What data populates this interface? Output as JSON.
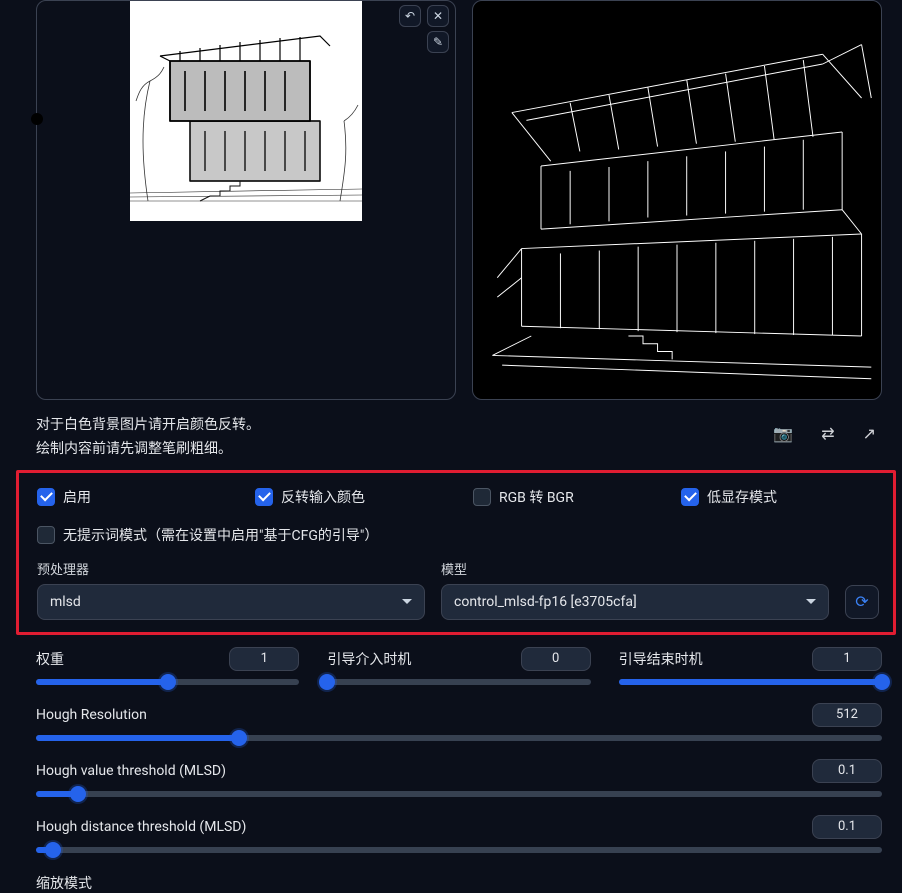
{
  "captions": {
    "line1": "对于白色背景图片请开启颜色反转。",
    "line2": "绘制内容前请先调整笔刷粗细。"
  },
  "toolbar_icons": {
    "camera": "camera-icon",
    "swap": "swap-icon",
    "out": "arrow-out-icon"
  },
  "checkboxes": {
    "enable": {
      "label": "启用",
      "checked": true
    },
    "invert": {
      "label": "反转输入颜色",
      "checked": true
    },
    "rgb_bgr": {
      "label": "RGB 转 BGR",
      "checked": false
    },
    "low_vram": {
      "label": "低显存模式",
      "checked": true
    },
    "no_prompt": {
      "label": "无提示词模式（需在设置中启用\"基于CFG的引导\"）",
      "checked": false
    }
  },
  "preprocessor": {
    "label": "预处理器",
    "value": "mlsd"
  },
  "model": {
    "label": "模型",
    "value": "control_mlsd-fp16 [e3705cfa]"
  },
  "sliders": {
    "weight": {
      "label": "权重",
      "value": "1",
      "percent": 50
    },
    "guide_start": {
      "label": "引导介入时机",
      "value": "0",
      "percent": 0
    },
    "guide_end": {
      "label": "引导结束时机",
      "value": "1",
      "percent": 100
    },
    "hough_res": {
      "label": "Hough Resolution",
      "value": "512",
      "percent": 24
    },
    "hough_val": {
      "label": "Hough value threshold (MLSD)",
      "value": "0.1",
      "percent": 5
    },
    "hough_dist": {
      "label": "Hough distance threshold (MLSD)",
      "value": "0.1",
      "percent": 2
    }
  },
  "scale_mode_label": "缩放模式"
}
